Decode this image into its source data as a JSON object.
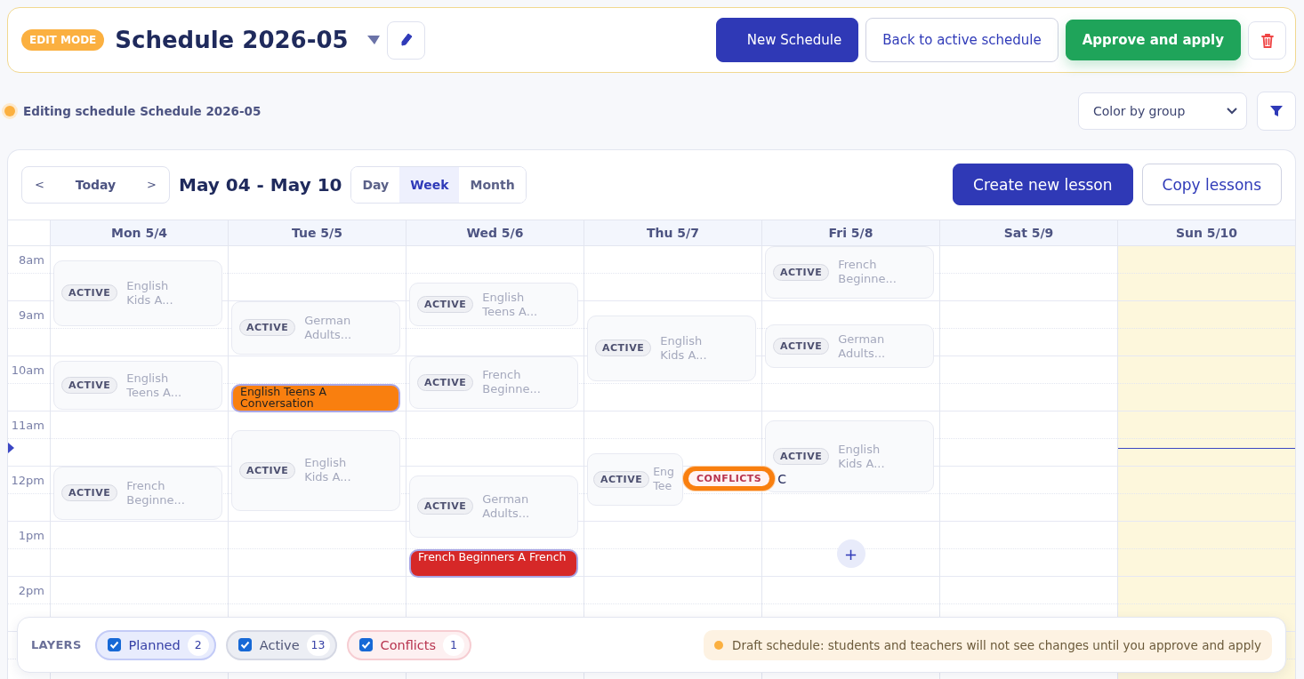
{
  "header": {
    "mode_badge": "EDIT MODE",
    "title": "Schedule 2026-05",
    "buttons": [
      {
        "label": "New Schedule",
        "kind": "primary"
      },
      {
        "label": "Back to active schedule",
        "kind": "outline"
      },
      {
        "label": "Approve and apply",
        "kind": "success"
      }
    ]
  },
  "status": {
    "text": "Editing schedule Schedule 2026-05",
    "color_mode": "Color by group"
  },
  "toolbar": {
    "prev": "<",
    "today": "Today",
    "next": ">",
    "range": "May 04 - May 10",
    "views": [
      {
        "label": "Day",
        "selected": false
      },
      {
        "label": "Week",
        "selected": true
      },
      {
        "label": "Month",
        "selected": false
      }
    ],
    "actions": [
      {
        "label": "Create new lesson",
        "kind": "primary"
      },
      {
        "label": "Copy lessons",
        "kind": "outline"
      }
    ]
  },
  "hours": [
    "8am",
    "9am",
    "10am",
    "11am",
    "12pm",
    "1pm",
    "2pm"
  ],
  "days": [
    {
      "label": "Mon 5/4",
      "today": false,
      "events": [
        {
          "kind": "active",
          "badge": "ACTIVE",
          "title": "English Kids A..."
        },
        {
          "kind": "active",
          "badge": "ACTIVE",
          "title": "English Teens A..."
        },
        {
          "kind": "active",
          "badge": "ACTIVE",
          "title": "French Beginne..."
        }
      ]
    },
    {
      "label": "Tue 5/5",
      "today": false,
      "events": [
        {
          "kind": "active",
          "badge": "ACTIVE",
          "title": "German Adults..."
        },
        {
          "kind": "planned",
          "title": "English Teens A Conversation",
          "color": "#f97f0f"
        },
        {
          "kind": "active",
          "badge": "ACTIVE",
          "title": "English Kids A..."
        }
      ]
    },
    {
      "label": "Wed 5/6",
      "today": false,
      "events": [
        {
          "kind": "active",
          "badge": "ACTIVE",
          "title": "English Teens A..."
        },
        {
          "kind": "active",
          "badge": "ACTIVE",
          "title": "French Beginne..."
        },
        {
          "kind": "active",
          "badge": "ACTIVE",
          "title": "German Adults..."
        },
        {
          "kind": "planned",
          "title": "French Beginners A French",
          "color": "#d62828"
        }
      ]
    },
    {
      "label": "Thu 5/7",
      "today": false,
      "events": [
        {
          "kind": "active",
          "badge": "ACTIVE",
          "title": "English Kids A..."
        },
        {
          "kind": "active",
          "badge": "ACTIVE",
          "title": "Eng Tee"
        },
        {
          "kind": "conflict",
          "badge": "CONFLICTS",
          "title": "C"
        }
      ]
    },
    {
      "label": "Fri 5/8",
      "today": false,
      "events": [
        {
          "kind": "active",
          "badge": "ACTIVE",
          "title": "French Beginne..."
        },
        {
          "kind": "active",
          "badge": "ACTIVE",
          "title": "German Adults..."
        },
        {
          "kind": "active",
          "badge": "ACTIVE",
          "title": "English Kids A..."
        }
      ],
      "add_button": "+"
    },
    {
      "label": "Sat 5/9",
      "today": false
    },
    {
      "label": "Sun 5/10",
      "today": true
    }
  ],
  "layers": {
    "title": "LAYERS",
    "items": [
      {
        "kind": "planned",
        "label": "Planned",
        "count": "2",
        "checked": true
      },
      {
        "kind": "active",
        "label": "Active",
        "count": "13",
        "checked": true
      },
      {
        "kind": "conflicts",
        "label": "Conflicts",
        "count": "1",
        "checked": true
      }
    ],
    "notice": "Draft schedule: students and teachers will not see changes until you approve and apply"
  }
}
